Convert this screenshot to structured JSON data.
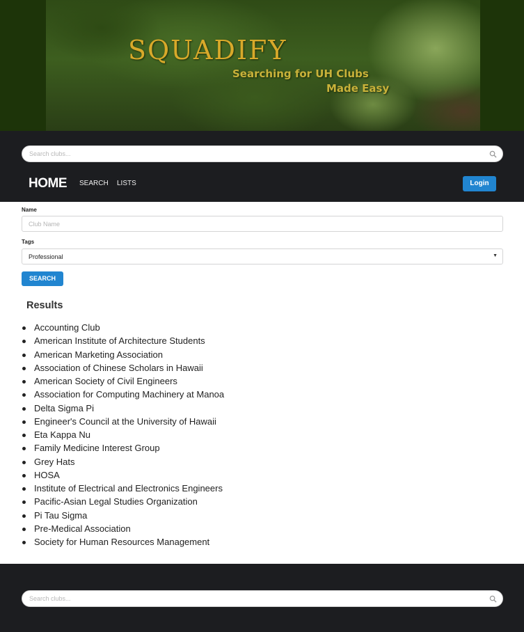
{
  "banner": {
    "brand": "SQUADIFY",
    "tagline_line1": "Searching for UH Clubs",
    "tagline_line2": "Made Easy"
  },
  "top_search": {
    "placeholder": "Search clubs..."
  },
  "nav": {
    "home": "HOME",
    "search": "SEARCH",
    "lists": "LISTS",
    "login": "Login"
  },
  "form": {
    "name_label": "Name",
    "name_placeholder": "Club Name",
    "tags_label": "Tags",
    "tags_selected": "Professional",
    "search_button": "SEARCH"
  },
  "results": {
    "title": "Results",
    "items": [
      "Accounting Club",
      "American Institute of Architecture Students",
      "American Marketing Association",
      "Association of Chinese Scholars in Hawaii",
      "American Society of Civil Engineers",
      "Association for Computing Machinery at Manoa",
      "Delta Sigma Pi",
      "Engineer's Council at the University of Hawaii",
      "Eta Kappa Nu",
      "Family Medicine Interest Group",
      "Grey Hats",
      "HOSA",
      "Institute of Electrical and Electronics Engineers",
      "Pacific-Asian Legal Studies Organization",
      "Pi Tau Sigma",
      "Pre-Medical Association",
      "Society for Human Resources Management"
    ]
  },
  "footer_search": {
    "placeholder": "Search clubs..."
  },
  "colors": {
    "dark_bar": "#1c1d20",
    "primary_button": "#2185d0",
    "brand_gold": "#d8a92a"
  }
}
